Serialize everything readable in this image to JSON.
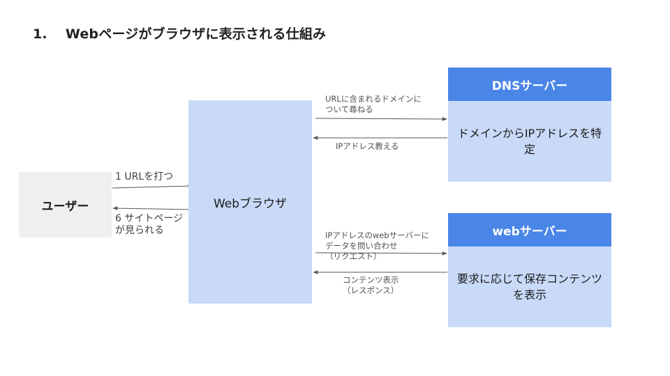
{
  "title": "1.　 Webページがブラウザに表示される仕組み",
  "nodes": {
    "user": "ユーザー",
    "browser": "Webブラウザ",
    "dns_server": {
      "header": "DNSサーバー",
      "body": "ドメインからIPアドレスを特定"
    },
    "web_server": {
      "header": "webサーバー",
      "body": "要求に応じて保存コンテンツを表示"
    }
  },
  "edges": {
    "user_to_browser": "1 URLを打つ",
    "browser_to_user": "6 サイトページ\nが見られる",
    "browser_to_dns": "URLに含まれるドメインに\nついて尋ねる",
    "dns_to_browser": "IPアドレス教える",
    "browser_to_web": "IPアドレスのwebサーバーに\nデータを問い合わせ\n（リクエスト）",
    "web_to_browser": "コンテンツ表示\n（レスポンス）"
  },
  "colors": {
    "server_header": "#4a86e8",
    "light_blue": "#c9daf8",
    "user_gray": "#efefef",
    "arrow": "#555555"
  }
}
